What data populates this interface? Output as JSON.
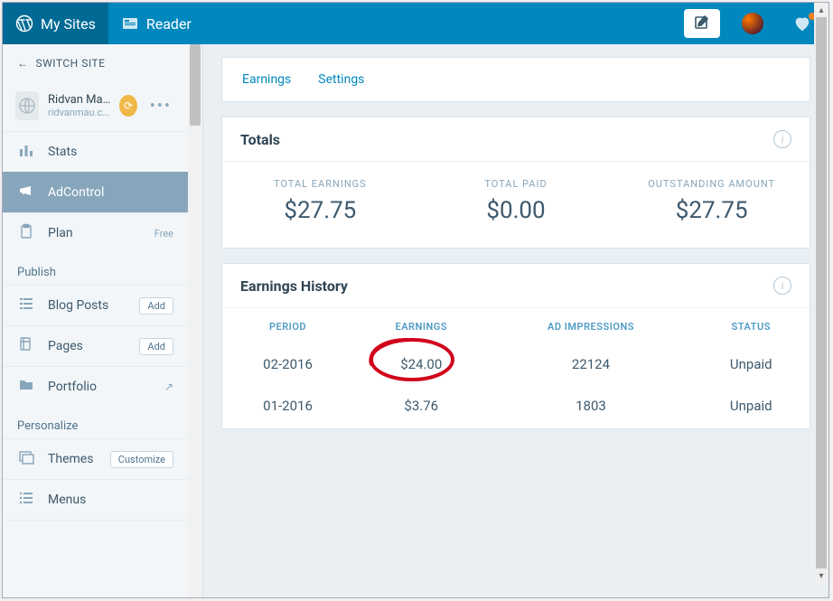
{
  "masterbar": {
    "my_sites": "My Sites",
    "reader": "Reader"
  },
  "sidebar": {
    "switch_site": "SWITCH SITE",
    "site_name": "Ridvan Ma…",
    "site_url": "ridvanmau.c…",
    "items": {
      "stats": "Stats",
      "adcontrol": "AdControl",
      "plan": "Plan",
      "plan_badge": "Free",
      "blog_posts": "Blog Posts",
      "pages": "Pages",
      "portfolio": "Portfolio",
      "themes": "Themes",
      "menus": "Menus",
      "add": "Add",
      "customize": "Customize"
    },
    "headings": {
      "publish": "Publish",
      "personalize": "Personalize"
    }
  },
  "tabs": {
    "earnings": "Earnings",
    "settings": "Settings"
  },
  "totals": {
    "title": "Totals",
    "total_earnings_label": "TOTAL EARNINGS",
    "total_earnings": "$27.75",
    "total_paid_label": "TOTAL PAID",
    "total_paid": "$0.00",
    "outstanding_label": "OUTSTANDING AMOUNT",
    "outstanding": "$27.75"
  },
  "history": {
    "title": "Earnings History",
    "cols": {
      "period": "PERIOD",
      "earnings": "EARNINGS",
      "impressions": "AD IMPRESSIONS",
      "status": "STATUS"
    },
    "rows": [
      {
        "period": "02-2016",
        "earnings": "$24.00",
        "impressions": "22124",
        "status": "Unpaid"
      },
      {
        "period": "01-2016",
        "earnings": "$3.76",
        "impressions": "1803",
        "status": "Unpaid"
      }
    ]
  },
  "chart_data": {
    "type": "table",
    "title": "AdControl Earnings",
    "totals": {
      "total_earnings_usd": 27.75,
      "total_paid_usd": 0.0,
      "outstanding_usd": 27.75
    },
    "columns": [
      "period",
      "earnings_usd",
      "ad_impressions",
      "status"
    ],
    "rows": [
      {
        "period": "02-2016",
        "earnings_usd": 24.0,
        "ad_impressions": 22124,
        "status": "Unpaid"
      },
      {
        "period": "01-2016",
        "earnings_usd": 3.76,
        "ad_impressions": 1803,
        "status": "Unpaid"
      }
    ]
  }
}
